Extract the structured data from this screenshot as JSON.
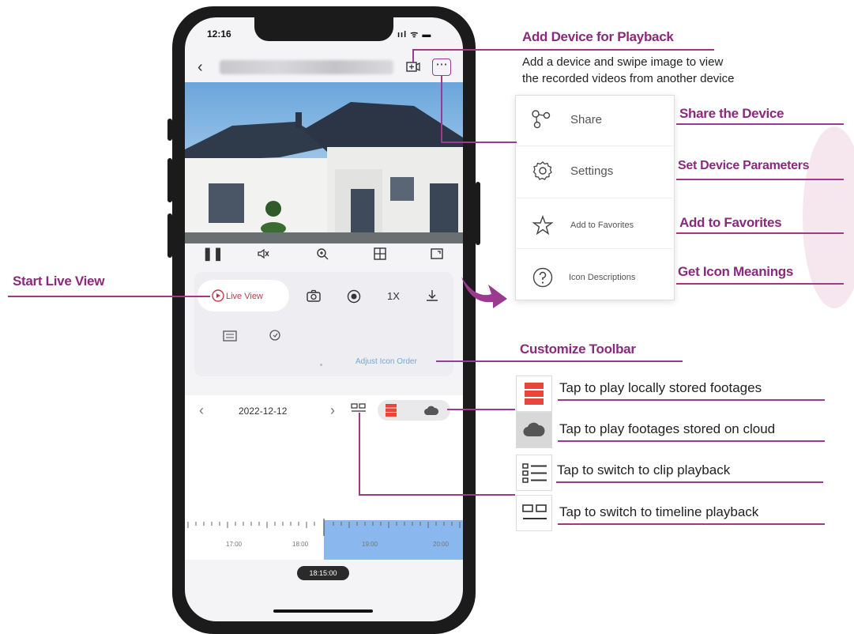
{
  "phone": {
    "status_time": "12:16",
    "status_icons": "ııl ᯤ ▬",
    "date": "2022-12-12",
    "live_view_label": "Live View",
    "speed_label": "1X",
    "adjust_icon_order": "Adjust Icon Order",
    "timeline_ticks": [
      "17:00",
      "18:00",
      "19:00",
      "20:00"
    ],
    "current_time": "18:15:00"
  },
  "menu": {
    "items": [
      {
        "label": "Share",
        "icon": "share-icon"
      },
      {
        "label": "Settings",
        "icon": "gear-icon"
      },
      {
        "label": "Add to Favorites",
        "icon": "star-icon"
      },
      {
        "label": "Icon Descriptions",
        "icon": "question-icon"
      }
    ]
  },
  "callouts": {
    "add_device_title": "Add Device for Playback",
    "add_device_desc_1": "Add a device and swipe image to view",
    "add_device_desc_2": "the recorded videos from another device",
    "share": "Share the Device",
    "settings": "Set Device Parameters",
    "favorites": "Add to Favorites",
    "icons": "Get Icon Meanings",
    "live_view": "Start Live View",
    "toolbar": "Customize Toolbar"
  },
  "legend": {
    "local": "Tap to play locally stored footages",
    "cloud": "Tap to play footages stored on cloud",
    "clip": "Tap to switch to clip playback",
    "timeline": "Tap to switch to timeline playback"
  },
  "colors": {
    "accent": "#9b3a8e",
    "local_red": "#e8453c",
    "timeline_blue": "#8ab8ee"
  }
}
